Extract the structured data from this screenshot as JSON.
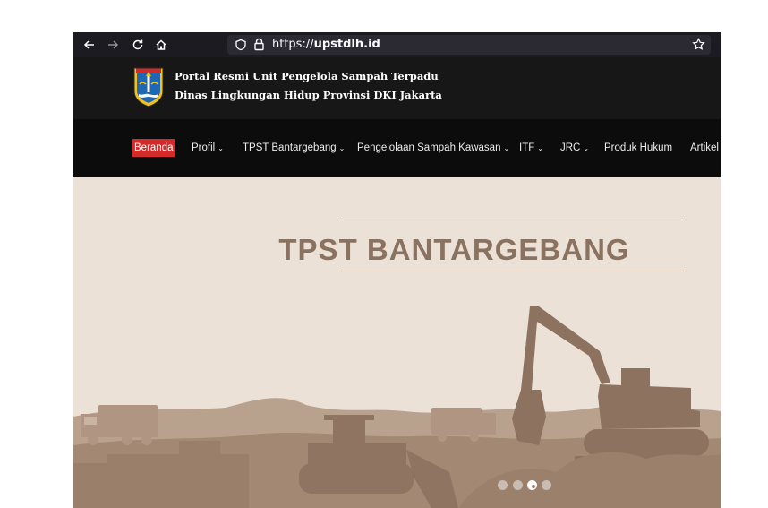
{
  "browser": {
    "back_icon": "arrow-left-icon",
    "forward_icon": "arrow-right-icon",
    "reload_icon": "reload-icon",
    "home_icon": "home-icon",
    "url_prefix": "https://",
    "url_host": "upstdlh.id",
    "bookmark_icon": "star-icon"
  },
  "header": {
    "title_line1": "Portal Resmi Unit Pengelola Sampah Terpadu",
    "title_line2": "Dinas Lingkungan Hidup Provinsi DKI Jakarta"
  },
  "nav": {
    "items": [
      {
        "label": "Beranda",
        "dropdown": false,
        "active": true
      },
      {
        "label": "Profil",
        "dropdown": true
      },
      {
        "label": "TPST Bantargebang",
        "dropdown": true
      },
      {
        "label": "Pengelolaan Sampah Kawasan",
        "dropdown": true
      },
      {
        "label": "ITF",
        "dropdown": true
      },
      {
        "label": "JRC",
        "dropdown": true
      },
      {
        "label": "Produk Hukum",
        "dropdown": false
      },
      {
        "label": "Artikel",
        "dropdown": false
      }
    ],
    "chevron": "⌄"
  },
  "hero": {
    "title": "TPST BANTARGEBANG",
    "slide_count": 4,
    "active_slide": 3
  },
  "colors": {
    "active_nav": "#d32a2a",
    "hero_bg": "#ece1d6",
    "silhouette": "#a48a75"
  }
}
